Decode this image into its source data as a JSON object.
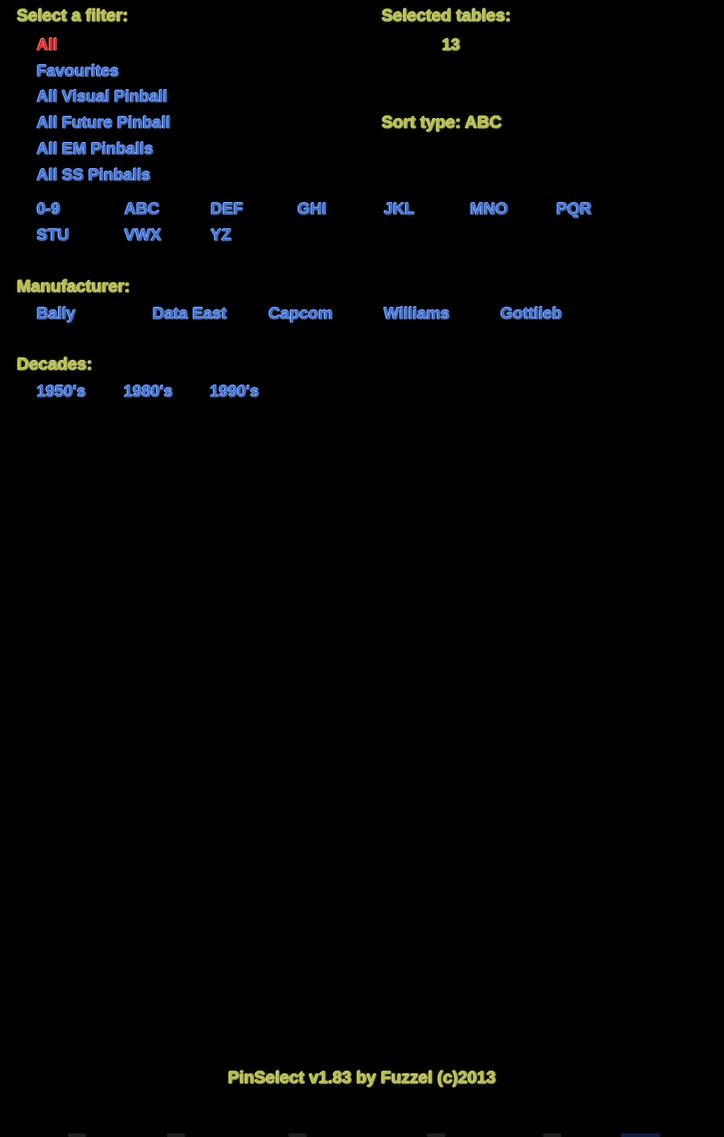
{
  "app": {
    "footer": "PinSelect v1.83 by Fuzzel (c)2013",
    "colors": {
      "background": "#000000",
      "heading": "#b6bc4b",
      "item": "#3d6fd6",
      "selected": "#e02626"
    }
  },
  "filter_panel": {
    "heading": "Select a filter:",
    "items": [
      {
        "label": "All",
        "selected": true
      },
      {
        "label": "Favourites",
        "selected": false
      },
      {
        "label": "All Visual Pinball",
        "selected": false
      },
      {
        "label": "All Future Pinball",
        "selected": false
      },
      {
        "label": "All EM Pinballs",
        "selected": false
      },
      {
        "label": "All SS Pinballs",
        "selected": false
      }
    ]
  },
  "letter_groups": {
    "items": [
      "0-9",
      "ABC",
      "DEF",
      "GHI",
      "JKL",
      "MNO",
      "PQR",
      "STU",
      "VWX",
      "YZ"
    ]
  },
  "manufacturer": {
    "heading": "Manufacturer:",
    "items": [
      "Bally",
      "Data East",
      "Capcom",
      "Williams",
      "Gottlieb"
    ]
  },
  "decades": {
    "heading": "Decades:",
    "items": [
      "1950's",
      "1980's",
      "1990's"
    ]
  },
  "status": {
    "selected_tables_label": "Selected tables:",
    "selected_tables_count": "13",
    "sort_type": "Sort type: ABC"
  }
}
